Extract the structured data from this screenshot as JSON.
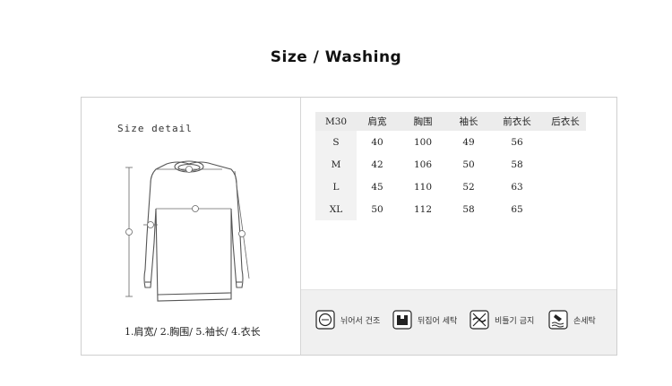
{
  "title": "Size / Washing",
  "size_detail_label": "Size detail",
  "legend": "1.肩宽/ 2.胸围/ 5.袖长/ 4.衣长",
  "table": {
    "headers": [
      "M30",
      "肩宽",
      "胸围",
      "袖长",
      "前衣长",
      "后衣长"
    ],
    "rows": [
      {
        "size": "S",
        "values": [
          "40",
          "100",
          "49",
          "56",
          ""
        ]
      },
      {
        "size": "M",
        "values": [
          "42",
          "106",
          "50",
          "58",
          ""
        ]
      },
      {
        "size": "L",
        "values": [
          "45",
          "110",
          "52",
          "63",
          ""
        ]
      },
      {
        "size": "XL",
        "values": [
          "50",
          "112",
          "58",
          "65",
          ""
        ]
      }
    ]
  },
  "washing": [
    {
      "icon": "tumble-dry-icon",
      "label": "뉘어서 건조"
    },
    {
      "icon": "inside-out-icon",
      "label": "뒤집어 세탁"
    },
    {
      "icon": "no-wring-icon",
      "label": "비틀기 금지"
    },
    {
      "icon": "hand-wash-icon",
      "label": "손세탁"
    }
  ]
}
